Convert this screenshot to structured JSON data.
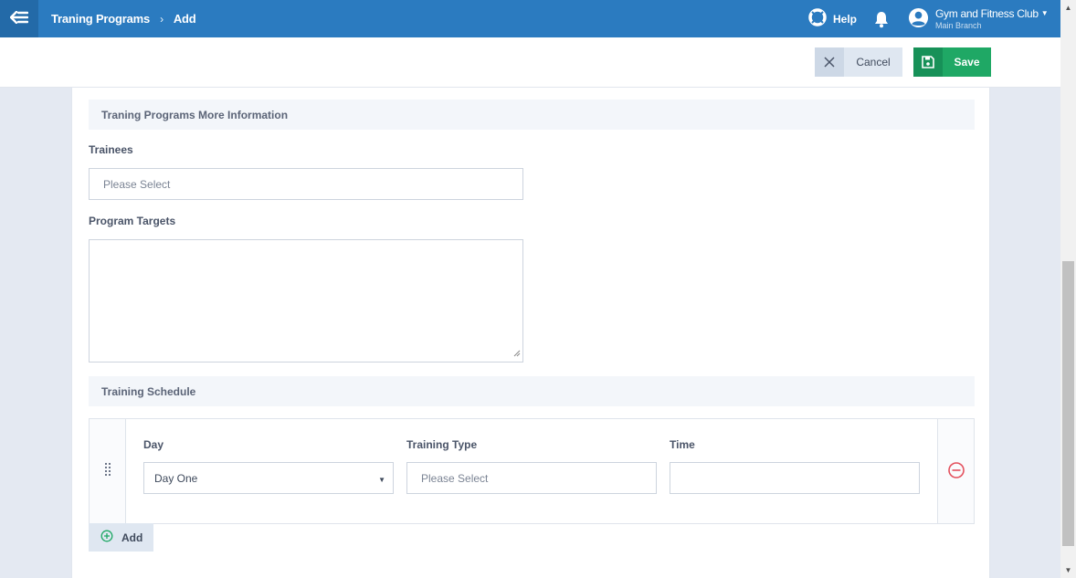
{
  "header": {
    "breadcrumb": [
      "Traning Programs",
      "Add"
    ],
    "breadcrumb_separator": "›",
    "help_label": "Help",
    "user": {
      "name": "Gym and Fitness Club",
      "branch": "Main Branch"
    }
  },
  "actions": {
    "cancel_label": "Cancel",
    "save_label": "Save"
  },
  "form": {
    "section_more_info": "Traning Programs More Information",
    "trainees_label": "Trainees",
    "trainees_placeholder": "Please Select",
    "targets_label": "Program Targets",
    "targets_value": "",
    "section_schedule": "Training Schedule",
    "schedule": {
      "day_label": "Day",
      "day_value": "Day One",
      "type_label": "Training Type",
      "type_placeholder": "Please Select",
      "time_label": "Time",
      "time_value": ""
    },
    "add_label": "Add"
  },
  "colors": {
    "header": "#2b7bc0",
    "save": "#1fa865",
    "cancel": "#dfe7f1",
    "remove": "#e4515e",
    "add_icon": "#1fa865"
  },
  "icons": {
    "back": "arrow-left-menu-icon",
    "help": "lifebuoy-icon",
    "bell": "bell-icon",
    "user": "user-circle-icon",
    "cancel": "close-icon",
    "save": "floppy-disk-icon",
    "drag": "drag-handle-icon",
    "remove": "minus-circle-icon",
    "add": "plus-circle-icon"
  }
}
